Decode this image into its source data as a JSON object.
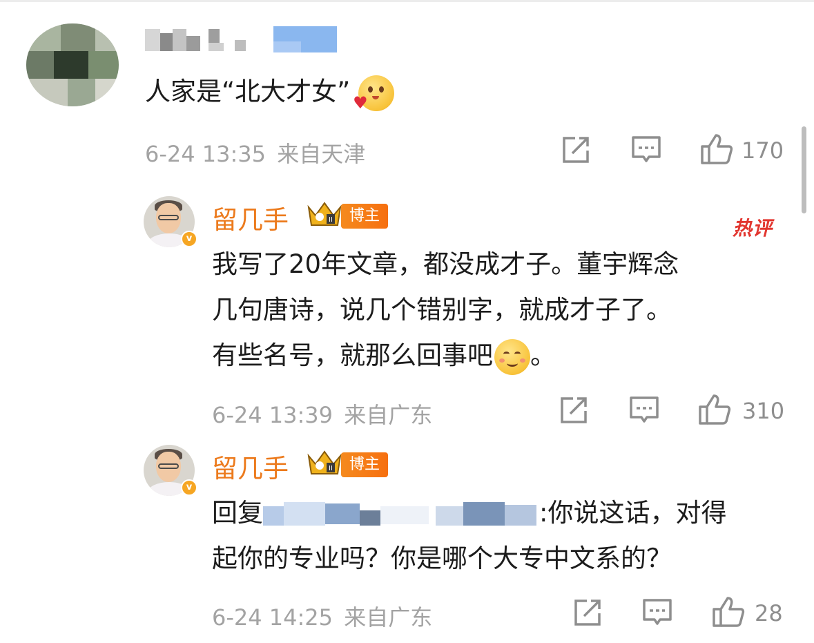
{
  "comments": [
    {
      "id": "c1",
      "text": "人家是“北大才女”",
      "emoji": "heart-emoji",
      "time": "6-24 13:35",
      "location": "来自天津",
      "likes": "170"
    }
  ],
  "replies": [
    {
      "id": "r1",
      "username": "留几手",
      "badge": "博主",
      "hot_tag": "热评",
      "lines": [
        "我写了20年文章，都没成才子。董宇辉念",
        "几句唐诗，说几个错别字，就成才子了。",
        "有些名号，就那么回事吧"
      ],
      "line3_suffix": "。",
      "emoji": "smile-emoji",
      "time": "6-24 13:39",
      "location": "来自广东",
      "likes": "310"
    },
    {
      "id": "r2",
      "username": "留几手",
      "badge": "博主",
      "reply_prefix": "回复",
      "line1_suffix": ":你说这话，对得",
      "line2": "起你的专业吗？你是哪个大专中文系的？",
      "time": "6-24 14:25",
      "location": "来自广东",
      "likes": "28"
    }
  ],
  "colors": {
    "username": "#ec7a1c",
    "meta": "#a3a3a3",
    "hot": "#e2362f",
    "badge": "#f6a623"
  }
}
